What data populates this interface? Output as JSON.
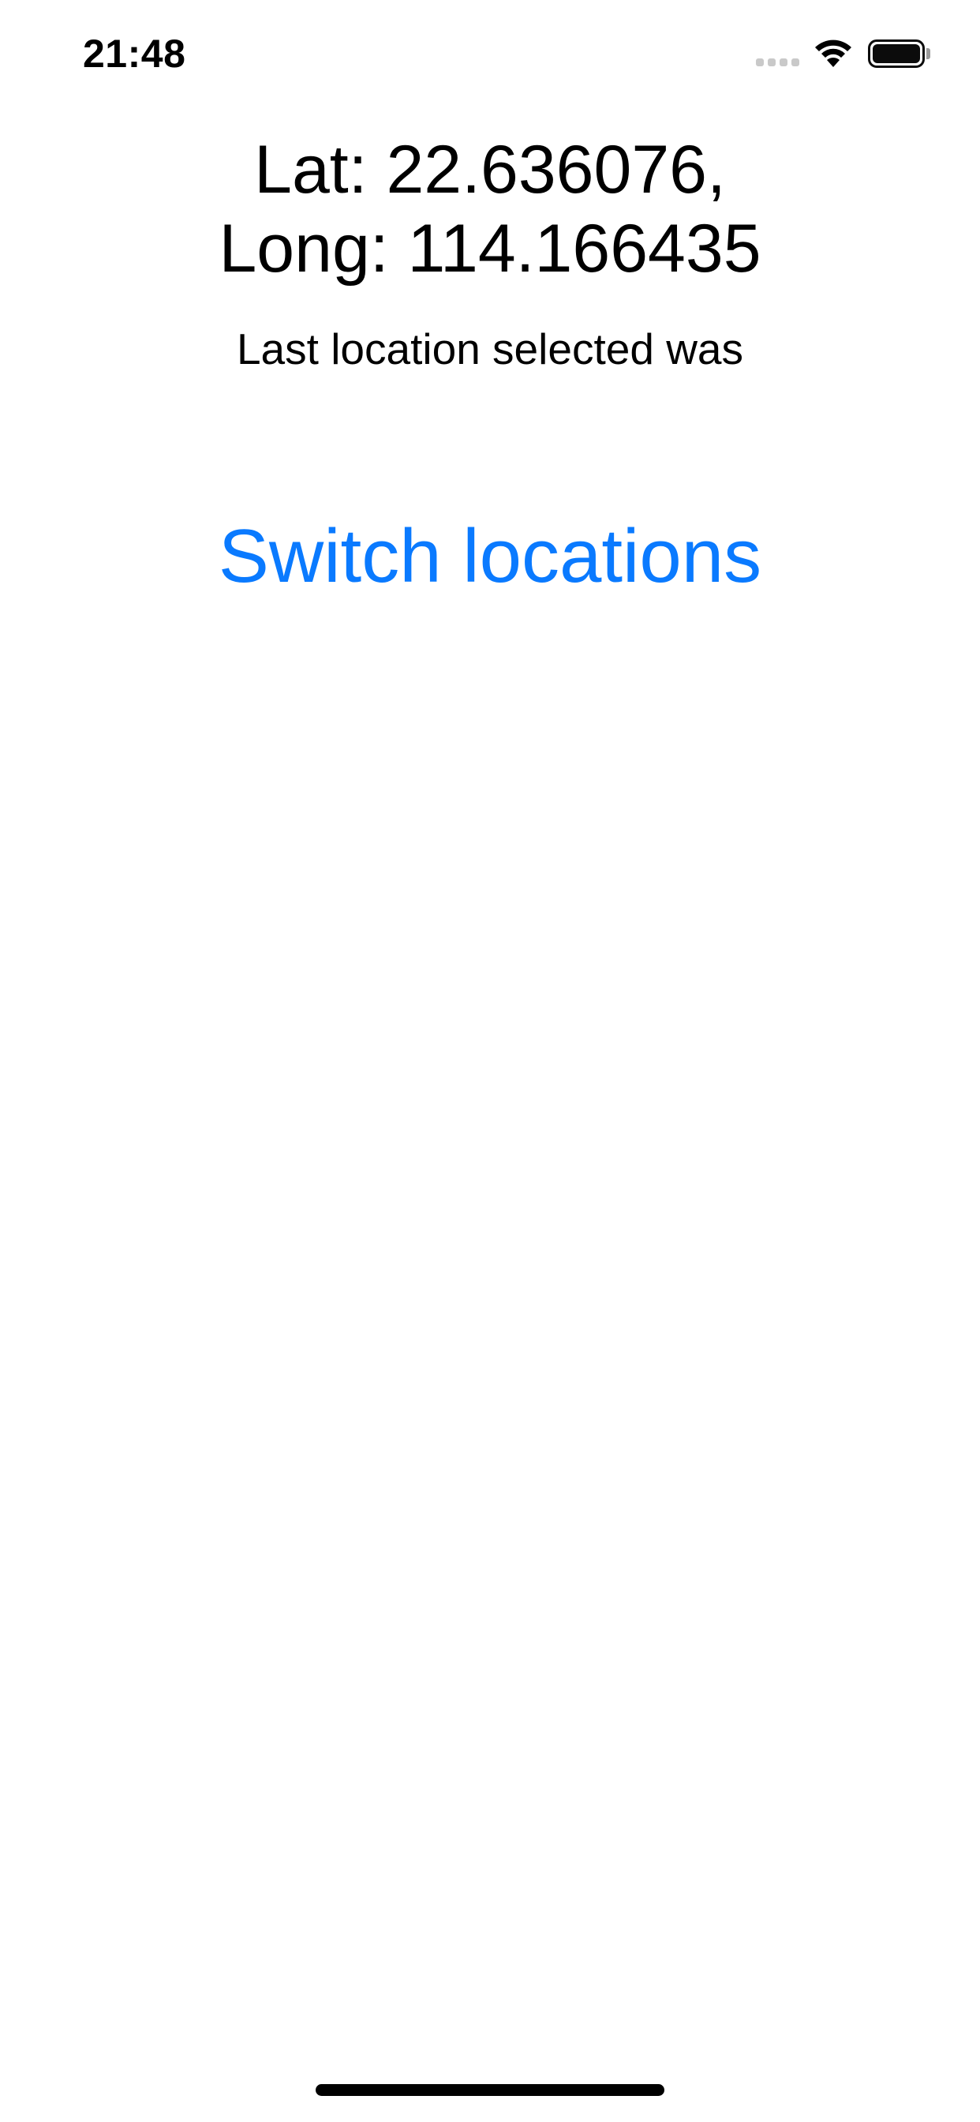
{
  "status_bar": {
    "time": "21:48",
    "icons": [
      "cellular-signal-icon",
      "wifi-icon",
      "battery-icon"
    ]
  },
  "location": {
    "lat_line": "Lat: 22.636076,",
    "long_line": "Long: 114.166435",
    "last_location_label": "Last location selected was"
  },
  "actions": {
    "switch_label": "Switch locations"
  },
  "colors": {
    "accent": "#0a7aff",
    "text": "#000000",
    "background": "#ffffff",
    "inactive_signal": "#c9c9c9"
  }
}
